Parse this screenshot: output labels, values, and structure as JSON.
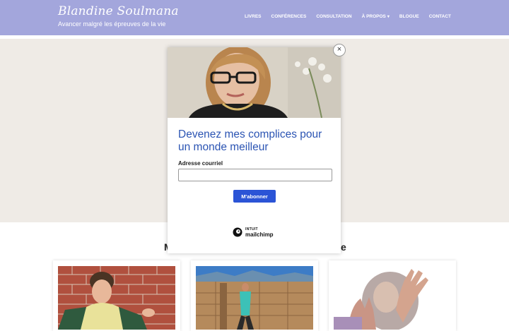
{
  "header": {
    "brand_title": "Blandine Soulmana",
    "brand_tagline": "Avancer malgré les épreuves de la vie",
    "nav": [
      {
        "label": "LIVRES"
      },
      {
        "label": "CONFÉRENCES"
      },
      {
        "label": "CONSULTATION"
      },
      {
        "label": "À PROPOS",
        "has_dropdown": true
      },
      {
        "label": "BLOGUE"
      },
      {
        "label": "CONTACT"
      }
    ],
    "background_color": "#a3a6dc"
  },
  "section": {
    "title_start": "M",
    "title_end": "e"
  },
  "popup": {
    "close_label": "×",
    "heading": "Devenez mes complices pour un monde meilleur",
    "email_label": "Adresse courriel",
    "email_value": "",
    "subscribe_label": "M'abonner",
    "footer_brand_small": "INTUIT",
    "footer_brand": "mailchimp",
    "heading_color": "#2b54b3",
    "button_color": "#2b54d6"
  },
  "cards": [
    {
      "image": "boy-crying-brick-wall"
    },
    {
      "image": "person-climbing-wooden-wall"
    },
    {
      "image": "hand-raised-defensive"
    }
  ]
}
